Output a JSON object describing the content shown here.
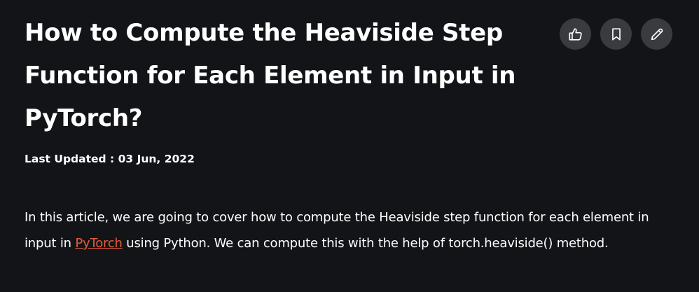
{
  "article": {
    "title": "How to Compute the Heaviside Step Function for Each Element in Input in PyTorch?",
    "last_updated_label": "Last Updated : ",
    "last_updated_date": "03 Jun, 2022",
    "paragraph": {
      "before_link": "In this article, we are going to cover how to compute the Heaviside step function for each element in input in ",
      "link_text": "PyTorch",
      "after_link": " using Python. We can compute this with the help of torch.heaviside() method."
    }
  },
  "actions": [
    {
      "name": "like",
      "icon": "thumbs-up-icon"
    },
    {
      "name": "bookmark",
      "icon": "bookmark-icon"
    },
    {
      "name": "edit",
      "icon": "pencil-icon"
    }
  ],
  "colors": {
    "background": "#131417",
    "text": "#ffffff",
    "link": "#e55b3c",
    "action_button": "#3a3b3e"
  }
}
